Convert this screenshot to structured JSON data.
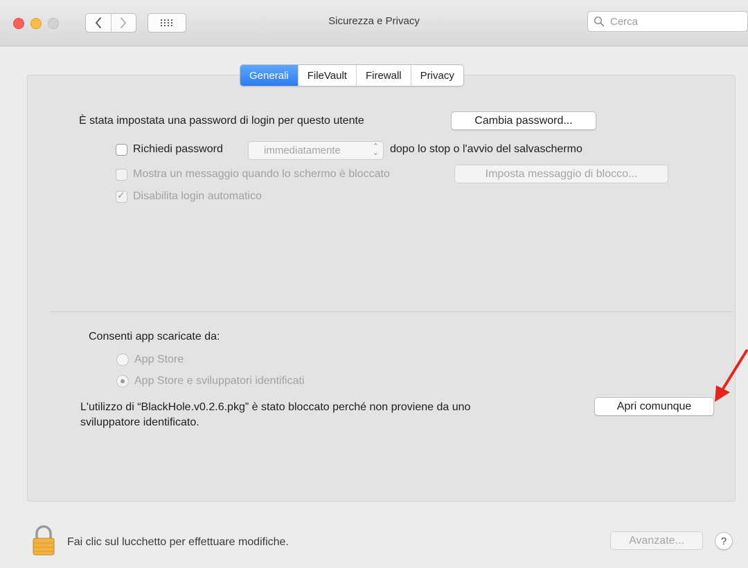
{
  "window": {
    "title": "Sicurezza e Privacy",
    "search_placeholder": "Cerca",
    "nav_back_icon": "chevron-left-icon",
    "nav_forward_icon": "chevron-right-icon",
    "grid_icon": "show-all-grid-icon"
  },
  "tabs": [
    {
      "label": "Generali",
      "active": true
    },
    {
      "label": "FileVault",
      "active": false
    },
    {
      "label": "Firewall",
      "active": false
    },
    {
      "label": "Privacy",
      "active": false
    }
  ],
  "general": {
    "password_set_text": "È stata impostata una password di login per questo utente",
    "change_password_label": "Cambia password...",
    "require_password_label": "Richiedi password",
    "require_password_checked": false,
    "require_password_delay": "immediatamente",
    "require_password_suffix": "dopo lo stop o l'avvio del salvaschermo",
    "show_message_label": "Mostra un messaggio quando lo schermo è bloccato",
    "show_message_checked": false,
    "set_lock_message_label": "Imposta messaggio di blocco...",
    "disable_autologin_label": "Disabilita login automatico",
    "disable_autologin_checked": true
  },
  "apps": {
    "heading": "Consenti app scaricate da:",
    "options": [
      {
        "label": "App Store",
        "selected": false
      },
      {
        "label": "App Store e sviluppatori identificati",
        "selected": true
      }
    ],
    "blocked_line1": "L'utilizzo di “BlackHole.v0.2.6.pkg” è stato bloccato perché non proviene da uno",
    "blocked_line2": "sviluppatore identificato.",
    "open_anyway_label": "Apri comunque"
  },
  "footer": {
    "lock_text": "Fai clic sul lucchetto per effettuare modifiche.",
    "advanced_label": "Avanzate...",
    "help_label": "?"
  },
  "colors": {
    "accent": "#2a7df2",
    "annotation_arrow": "#e8231c",
    "close": "#fc605c",
    "minimize": "#fdbc40"
  }
}
